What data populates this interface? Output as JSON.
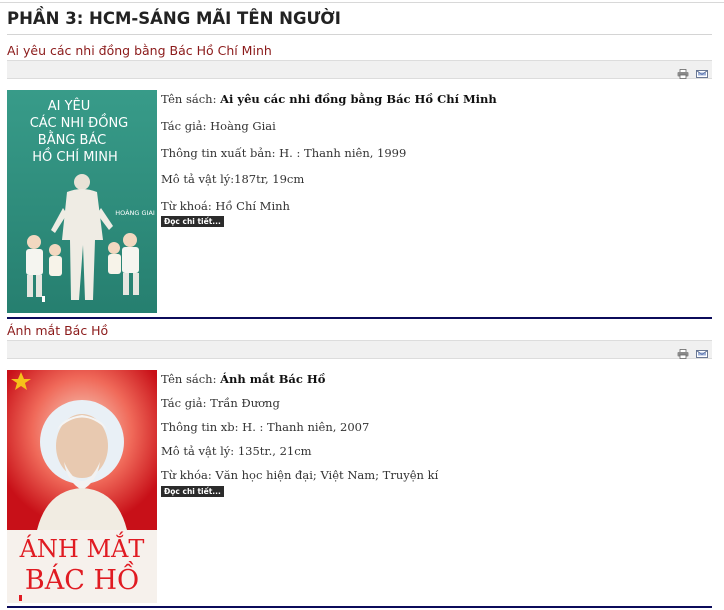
{
  "page": {
    "title": "PHẦN 3: HCM-SÁNG MÃI TÊN NGƯỜI"
  },
  "articles": [
    {
      "title": "Ai yêu các nhi đồng bằng Bác Hồ Chí Minh",
      "cover": {
        "lines": [
          "AI YÊU",
          "CÁC NHI ĐỒNG",
          "BẰNG BÁC",
          "HỒ CHÍ MINH"
        ],
        "author": "HOÀNG GIAI",
        "colors": {
          "bg": "#2e8f7e",
          "text": "#ffffff"
        }
      },
      "fields": [
        {
          "label": "Tên sách: ",
          "value": "Ai yêu các nhi đồng bằng Bác Hồ Chí Minh",
          "bold": true
        },
        {
          "label": "Tác giả: ",
          "value": "Hoàng Giai",
          "bold": false
        },
        {
          "label": "Thông tin xuất bản: ",
          "value": "H. : Thanh niên, 1999",
          "bold": false
        },
        {
          "label": "Mô tả vật lý:",
          "value": "187tr, 19cm",
          "bold": false
        },
        {
          "label": "Từ khoá: ",
          "value": "Hồ Chí Minh",
          "bold": false
        }
      ],
      "more_label": "Đọc chi tiết..."
    },
    {
      "title": "Ánh mắt Bác Hồ",
      "cover": {
        "lines": [
          "ÁNH MẮT",
          "BÁC HỒ"
        ],
        "colors": {
          "bg": "#e8232a",
          "text": "#e01b22"
        }
      },
      "fields": [
        {
          "label": "Tên sách: ",
          "value": "Ánh mắt Bác Hồ",
          "bold": true
        },
        {
          "label": "Tác giả: ",
          "value": "Trần Đương",
          "bold": false
        },
        {
          "label": "Thông tin xb: ",
          "value": "H. : Thanh niên, 2007",
          "bold": false
        },
        {
          "label": "Mô tả vật lý: ",
          "value": "135tr., 21cm",
          "bold": false
        },
        {
          "label": "Từ khóa: ",
          "value": "Văn học hiện đại; Việt Nam; Truyện kí",
          "bold": false
        }
      ],
      "more_label": "Đọc chi tiết..."
    }
  ],
  "icons": {
    "print": "printer-icon",
    "email": "email-icon"
  },
  "colors": {
    "title_link": "#8b1a1a",
    "divider": "#0b0b5a",
    "toolbar_bg": "#f0f0f0"
  }
}
